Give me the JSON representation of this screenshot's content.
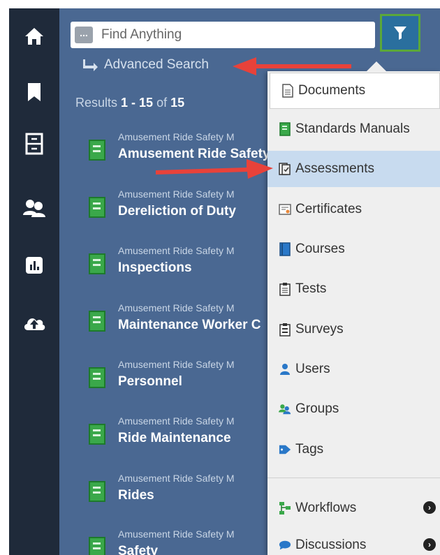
{
  "search": {
    "placeholder": "Find Anything",
    "pill_label": "..."
  },
  "filter_button": {
    "icon": "filter-icon",
    "color": "#2a6f9e",
    "border": "#5ba83a"
  },
  "advanced_search": {
    "label": "Advanced Search",
    "icon": "reply-arrow-icon"
  },
  "results": {
    "prefix": "Results ",
    "range": "1 - 15",
    "of_text": " of ",
    "total": "15",
    "items": [
      {
        "sub": "Amusement Ride Safety M",
        "title": "Amusement Ride Safety"
      },
      {
        "sub": "Amusement Ride Safety M",
        "title": "Dereliction of Duty"
      },
      {
        "sub": "Amusement Ride Safety M",
        "title": "Inspections"
      },
      {
        "sub": "Amusement Ride Safety M",
        "title": "Maintenance Worker C"
      },
      {
        "sub": "Amusement Ride Safety M",
        "title": "Personnel"
      },
      {
        "sub": "Amusement Ride Safety M",
        "title": "Ride Maintenance"
      },
      {
        "sub": "Amusement Ride Safety M",
        "title": "Rides"
      },
      {
        "sub": "Amusement Ride Safety M",
        "title": "Safety"
      }
    ]
  },
  "sidebar": {
    "items": [
      {
        "icon": "home-icon"
      },
      {
        "icon": "bookmark-icon"
      },
      {
        "icon": "cabinet-icon"
      },
      {
        "icon": "users-icon"
      },
      {
        "icon": "chart-icon"
      },
      {
        "icon": "cloud-upload-icon"
      }
    ]
  },
  "menu": {
    "items": [
      {
        "label": "Documents",
        "icon": "document-icon"
      },
      {
        "label": "Standards Manuals",
        "icon": "manual-icon"
      },
      {
        "label": "Assessments",
        "icon": "assessment-icon"
      },
      {
        "label": "Certificates",
        "icon": "certificate-icon"
      },
      {
        "label": "Courses",
        "icon": "course-icon"
      },
      {
        "label": "Tests",
        "icon": "test-icon"
      },
      {
        "label": "Surveys",
        "icon": "survey-icon"
      },
      {
        "label": "Users",
        "icon": "user-icon"
      },
      {
        "label": "Groups",
        "icon": "groups-icon"
      },
      {
        "label": "Tags",
        "icon": "tag-icon"
      },
      {
        "label": "Workflows",
        "icon": "workflow-icon"
      },
      {
        "label": "Discussions",
        "icon": "discussion-icon"
      }
    ],
    "active": "Assessments"
  },
  "colors": {
    "panel": "#4a6892",
    "rail": "#1f2a3a",
    "menu": "#efefef",
    "active": "#c8dbef",
    "callout_arrow": "#e8423a"
  }
}
